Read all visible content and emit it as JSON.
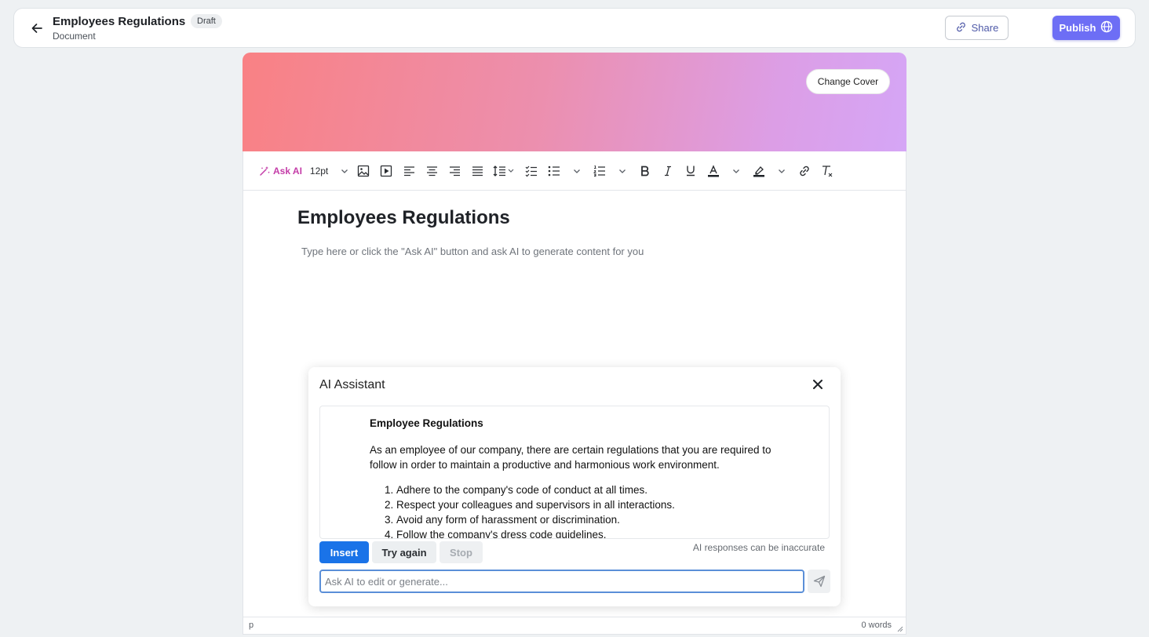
{
  "header": {
    "title": "Employees Regulations",
    "badge": "Draft",
    "subtitle": "Document",
    "share_label": "Share",
    "publish_label": "Publish"
  },
  "cover": {
    "change_cover_label": "Change Cover"
  },
  "toolbar": {
    "ask_ai_label": "Ask AI",
    "font_size": "12pt",
    "tools": [
      "image-icon",
      "video-icon",
      "align-left-icon",
      "align-center-icon",
      "align-right-icon",
      "align-justify-icon",
      "line-height-icon",
      "checklist-icon",
      "bullet-list-icon",
      "numbered-list-icon",
      "bold-icon",
      "italic-icon",
      "underline-icon",
      "text-color-icon",
      "highlight-icon",
      "link-icon",
      "clear-format-icon"
    ]
  },
  "editor": {
    "title": "Employees Regulations",
    "placeholder": "Type here or click the \"Ask AI\" button and ask AI to generate content for you",
    "status_block": "p",
    "word_count": "0 words"
  },
  "ai_assistant": {
    "title": "AI Assistant",
    "content": {
      "heading": "Employee Regulations",
      "paragraph": "As an employee of our company, there are certain regulations that you are required to follow in order to maintain a productive and harmonious work environment.",
      "items": [
        "Adhere to the company's code of conduct at all times.",
        "Respect your colleagues and supervisors in all interactions.",
        "Avoid any form of harassment or discrimination.",
        "Follow the company's dress code guidelines."
      ]
    },
    "insert_label": "Insert",
    "try_again_label": "Try again",
    "stop_label": "Stop",
    "disclaimer": "AI responses can be inaccurate",
    "input_placeholder": "Ask AI to edit or generate..."
  },
  "colors": {
    "accent": "#6d6ef5",
    "insert": "#1a73e8",
    "ask_ai": "#c43da8"
  }
}
